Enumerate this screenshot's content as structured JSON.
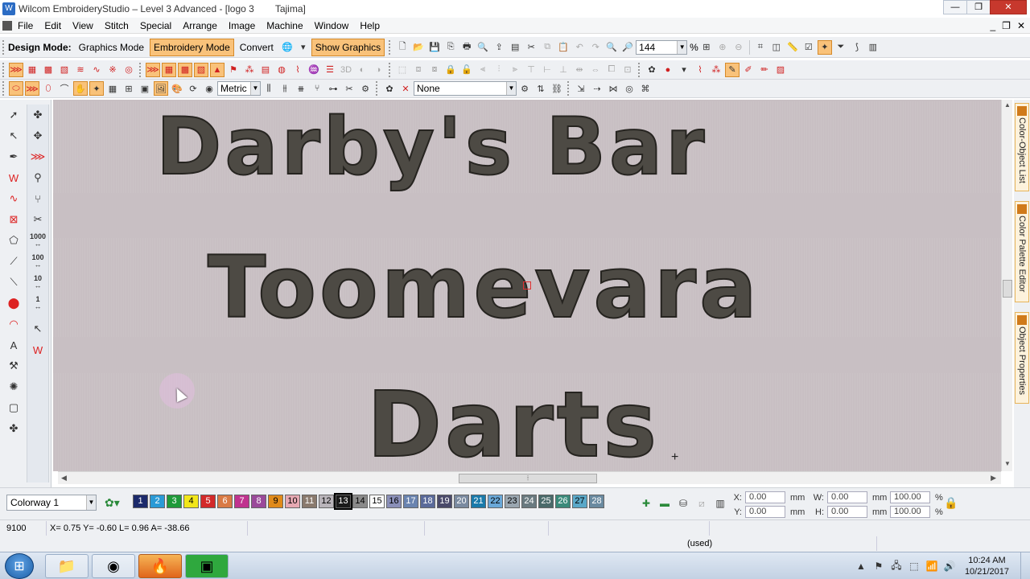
{
  "window": {
    "title_main": "Wilcom EmbroideryStudio – Level 3 Advanced - [logo 3",
    "title_machine": "Tajima]",
    "minimize": "—",
    "restore": "❐",
    "close": "✕"
  },
  "menu": {
    "items": [
      "File",
      "Edit",
      "View",
      "Stitch",
      "Special",
      "Arrange",
      "Image",
      "Machine",
      "Window",
      "Help"
    ],
    "mdi_minimize": "_",
    "mdi_restore": "❐",
    "mdi_close": "✕"
  },
  "toolbar1": {
    "design_mode_label": "Design Mode:",
    "graphics_mode": "Graphics Mode",
    "embroidery_mode": "Embroidery Mode",
    "convert": "Convert",
    "show_graphics": "Show Graphics",
    "zoom_value": "144",
    "zoom_unit": "%"
  },
  "toolbar3": {
    "units_value": "Metric",
    "needle_value": "None"
  },
  "canvas": {
    "line1": "Darby's Bar",
    "line2": "Toomevara",
    "line3": "Darts"
  },
  "left_tools": {
    "density_1000": "1000",
    "density_100": "100",
    "density_10": "10",
    "density_1": "1"
  },
  "dock_tabs": {
    "tab1": "Color-Object List",
    "tab2": "Color Palette Editor",
    "tab3": "Object Properties"
  },
  "colorbar": {
    "colorway": "Colorway 1",
    "swatches": [
      {
        "n": "1",
        "bg": "#1c2a6b",
        "fg": "#ffffff"
      },
      {
        "n": "2",
        "bg": "#2a9ad6",
        "fg": "#ffffff"
      },
      {
        "n": "3",
        "bg": "#1f9a3a",
        "fg": "#ffffff"
      },
      {
        "n": "4",
        "bg": "#f2e61b",
        "fg": "#000000"
      },
      {
        "n": "5",
        "bg": "#d32a2a",
        "fg": "#ffffff"
      },
      {
        "n": "6",
        "bg": "#d97a45",
        "fg": "#ffffff"
      },
      {
        "n": "7",
        "bg": "#c0338f",
        "fg": "#ffffff"
      },
      {
        "n": "8",
        "bg": "#9a4a9a",
        "fg": "#ffffff"
      },
      {
        "n": "9",
        "bg": "#e08a1a",
        "fg": "#000000"
      },
      {
        "n": "10",
        "bg": "#e6a8b2",
        "fg": "#000000"
      },
      {
        "n": "11",
        "bg": "#8a7a6e",
        "fg": "#ffffff"
      },
      {
        "n": "12",
        "bg": "#b9b4ba",
        "fg": "#000000"
      },
      {
        "n": "13",
        "bg": "#1a1a1a",
        "fg": "#ffffff"
      },
      {
        "n": "14",
        "bg": "#8a8a8a",
        "fg": "#000000"
      },
      {
        "n": "15",
        "bg": "#ffffff",
        "fg": "#000000"
      },
      {
        "n": "16",
        "bg": "#8a8fb8",
        "fg": "#000000"
      },
      {
        "n": "17",
        "bg": "#6a84b0",
        "fg": "#ffffff"
      },
      {
        "n": "18",
        "bg": "#5a6a9a",
        "fg": "#ffffff"
      },
      {
        "n": "19",
        "bg": "#4a4a6a",
        "fg": "#ffffff"
      },
      {
        "n": "20",
        "bg": "#7a8aa0",
        "fg": "#ffffff"
      },
      {
        "n": "21",
        "bg": "#1a7aaa",
        "fg": "#ffffff"
      },
      {
        "n": "22",
        "bg": "#6aa8d8",
        "fg": "#000000"
      },
      {
        "n": "23",
        "bg": "#9aa6b0",
        "fg": "#000000"
      },
      {
        "n": "24",
        "bg": "#6a7a80",
        "fg": "#ffffff"
      },
      {
        "n": "25",
        "bg": "#4a6a6a",
        "fg": "#ffffff"
      },
      {
        "n": "26",
        "bg": "#3a8a7a",
        "fg": "#ffffff"
      },
      {
        "n": "27",
        "bg": "#5aa8c8",
        "fg": "#000000"
      },
      {
        "n": "28",
        "bg": "#6a8aa0",
        "fg": "#ffffff"
      }
    ],
    "selected_index": 12,
    "x_label": "X:",
    "x_value": "0.00",
    "x_unit": "mm",
    "y_label": "Y:",
    "y_value": "0.00",
    "y_unit": "mm",
    "w_label": "W:",
    "w_value": "0.00",
    "w_unit": "mm",
    "h_label": "H:",
    "h_value": "0.00",
    "h_unit": "mm",
    "wp_value": "100.00",
    "wp_unit": "%",
    "hp_value": "100.00",
    "hp_unit": "%"
  },
  "status": {
    "stitch_count": "9100",
    "coords": "X=  0.75 Y=  -0.60 L=  0.96 A= -38.66",
    "used": "(used)"
  },
  "taskbar": {
    "time": "10:24 AM",
    "date": "10/21/2017"
  },
  "colors": {
    "accent_orange": "#f9c27a",
    "canvas_bg": "#c8bfc3",
    "thread_dark": "#4d4a44"
  }
}
